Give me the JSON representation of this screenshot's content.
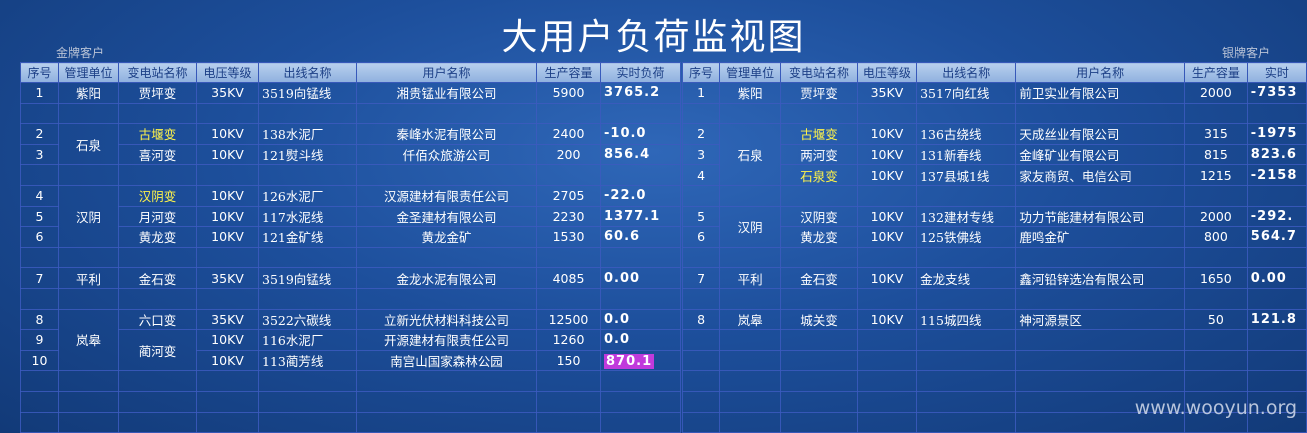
{
  "title": "大用户负荷监视图",
  "gold_label": "金牌客户",
  "silver_label": "银牌客户",
  "left_headers": [
    "序号",
    "管理单位",
    "变电站名称",
    "电压等级",
    "出线名称",
    "用户名称",
    "生产容量",
    "实时负荷"
  ],
  "right_headers": [
    "序号",
    "管理单位",
    "变电站名称",
    "电压等级",
    "出线名称",
    "用户名称",
    "生产容量",
    "实时"
  ],
  "left_rows": [
    {
      "no": "1",
      "unit": "紫阳",
      "station": "贾坪变",
      "voltage": "35KV",
      "line": "3519向锰线",
      "user": "湘贵锰业有限公司",
      "capacity": "5900",
      "load": "3765.2"
    },
    {
      "no": "2",
      "station": "古堰变",
      "voltage": "10KV",
      "line": "138水泥厂",
      "user": "秦峰水泥有限公司",
      "capacity": "2400",
      "load": "-10.0"
    },
    {
      "no": "3",
      "station": "喜河变",
      "voltage": "10KV",
      "line": "121熨斗线",
      "user": "仟佰众旅游公司",
      "capacity": "200",
      "load": "856.4"
    },
    {
      "no": "4",
      "station": "汉阴变",
      "voltage": "10KV",
      "line": "126水泥厂",
      "user": "汉源建材有限责任公司",
      "capacity": "2705",
      "load": "-22.0"
    },
    {
      "no": "5",
      "station": "月河变",
      "voltage": "10KV",
      "line": "117水泥线",
      "user": "金圣建材有限公司",
      "capacity": "2230",
      "load": "1377.1"
    },
    {
      "no": "6",
      "station": "黄龙变",
      "voltage": "10KV",
      "line": "121金矿线",
      "user": "黄龙金矿",
      "capacity": "1530",
      "load": "60.6"
    },
    {
      "no": "7",
      "unit": "平利",
      "station": "金石变",
      "voltage": "35KV",
      "line": "3519向锰线",
      "user": "金龙水泥有限公司",
      "capacity": "4085",
      "load": "0.00"
    },
    {
      "no": "8",
      "station": "六口变",
      "voltage": "35KV",
      "line": "3522六碳线",
      "user": "立新光伏材料科技公司",
      "capacity": "12500",
      "load": "0.0"
    },
    {
      "no": "9",
      "voltage": "10KV",
      "line": "116水泥厂",
      "user": "开源建材有限责任公司",
      "capacity": "1260",
      "load": "0.0"
    },
    {
      "no": "10",
      "voltage": "10KV",
      "line": "113蔺芳线",
      "user": "南宫山国家森林公园",
      "capacity": "150",
      "load": "870.1"
    }
  ],
  "left_groups": {
    "shiquan": "石泉",
    "hanyin": "汉阴",
    "langao": "岚皋",
    "linhe": "蔺河变"
  },
  "right_rows": [
    {
      "no": "1",
      "unit": "紫阳",
      "station": "贾坪变",
      "voltage": "35KV",
      "line": "3517向红线",
      "user": "前卫实业有限公司",
      "capacity": "2000",
      "load": "-7353"
    },
    {
      "no": "2",
      "station": "古堰变",
      "voltage": "10KV",
      "line": "136古绕线",
      "user": "天成丝业有限公司",
      "capacity": "315",
      "load": "-1975"
    },
    {
      "no": "3",
      "station": "两河变",
      "voltage": "10KV",
      "line": "131新春线",
      "user": "金峰矿业有限公司",
      "capacity": "815",
      "load": "823.6"
    },
    {
      "no": "4",
      "station": "石泉变",
      "voltage": "10KV",
      "line": "137县城1线",
      "user": "家友商贸、电信公司",
      "capacity": "1215",
      "load": "-2158"
    },
    {
      "no": "5",
      "station": "汉阴变",
      "voltage": "10KV",
      "line": "132建材专线",
      "user": "功力节能建材有限公司",
      "capacity": "2000",
      "load": "-292."
    },
    {
      "no": "6",
      "station": "黄龙变",
      "voltage": "10KV",
      "line": "125铁佛线",
      "user": "鹿鸣金矿",
      "capacity": "800",
      "load": "564.7"
    },
    {
      "no": "7",
      "unit": "平利",
      "station": "金石变",
      "voltage": "10KV",
      "line": "金龙支线",
      "user": "鑫河铅锌选冶有限公司",
      "capacity": "1650",
      "load": "0.00"
    },
    {
      "no": "8",
      "unit": "岚皋",
      "station": "城关变",
      "voltage": "10KV",
      "line": "115城四线",
      "user": "神河源景区",
      "capacity": "50",
      "load": "121.8"
    }
  ],
  "right_groups": {
    "shiquan": "石泉",
    "hanyin": "汉阴"
  },
  "watermark": "www.wooyun.org",
  "colors": {
    "highlight_station": "#fff34a",
    "highlight_load": "#c03adc",
    "header_bg": "#a9c4ea"
  }
}
